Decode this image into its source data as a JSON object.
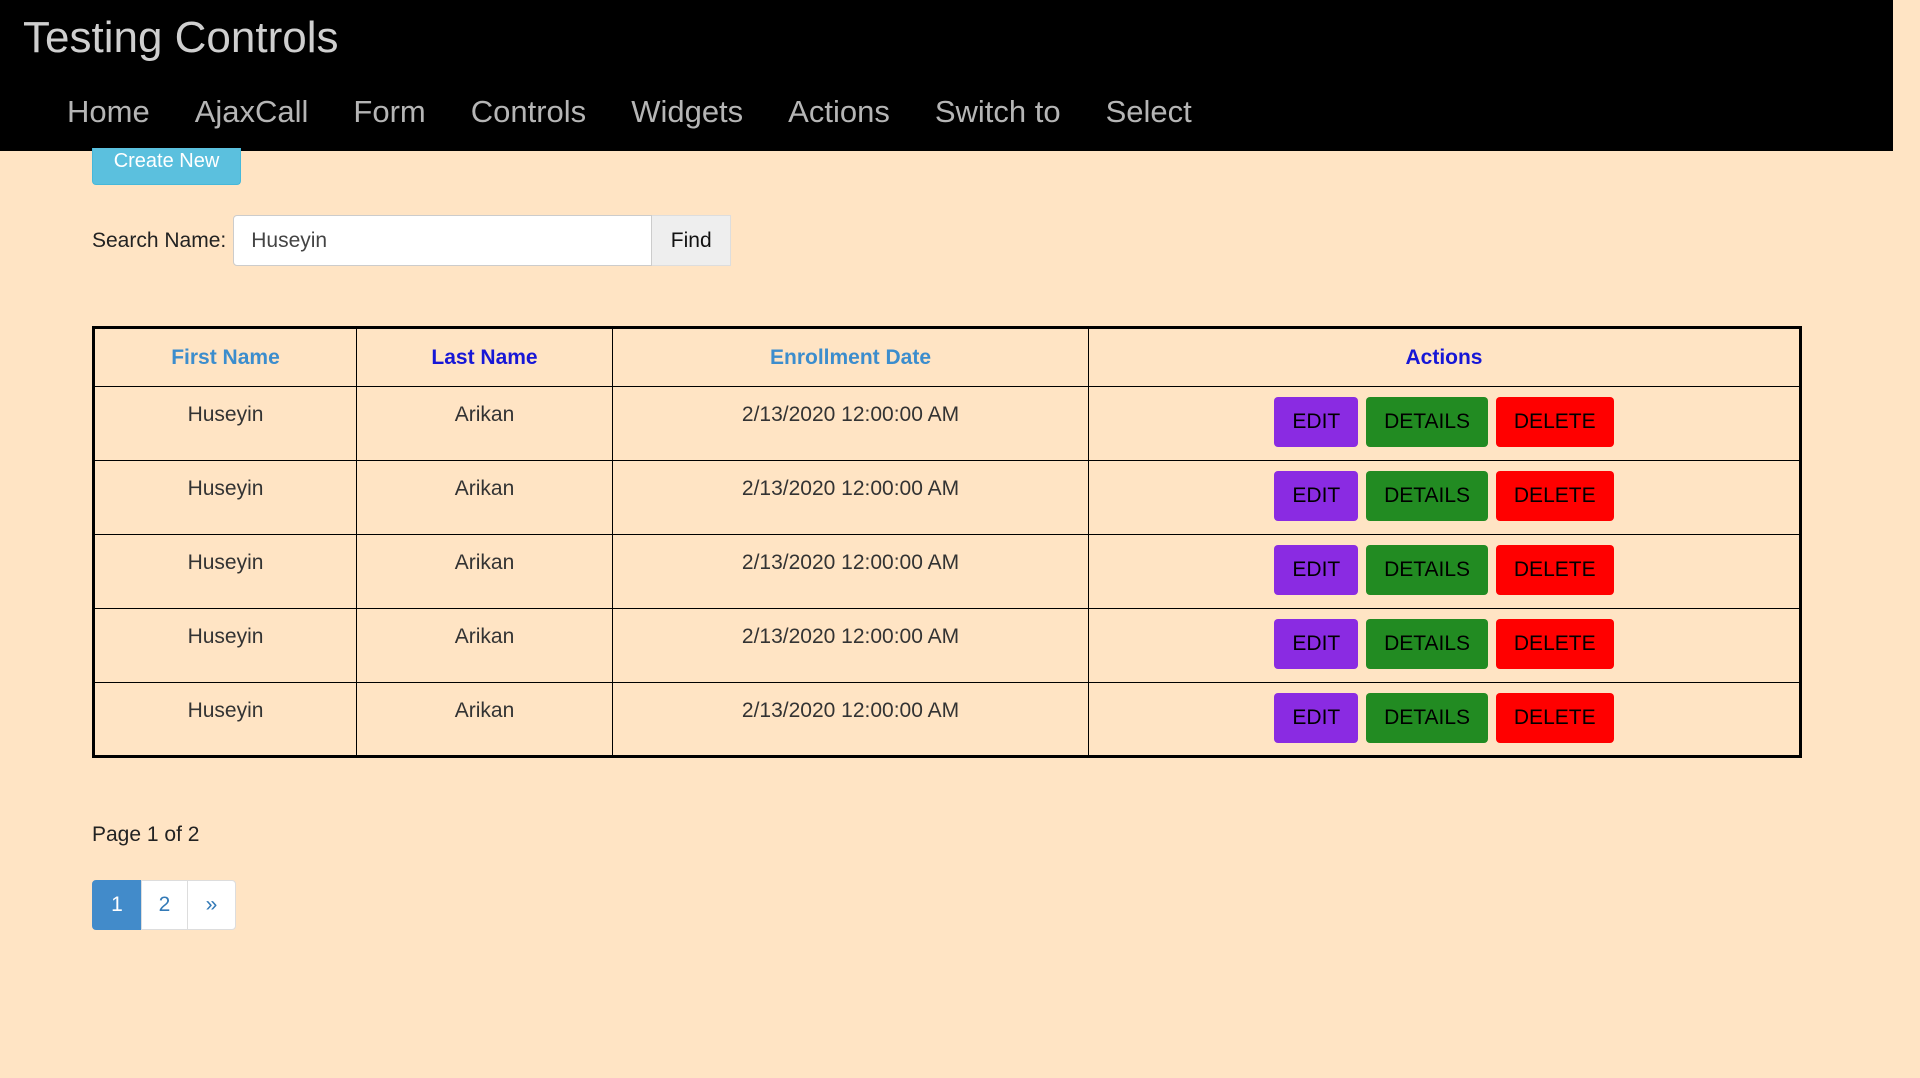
{
  "app": {
    "title": "Testing Controls"
  },
  "nav": {
    "items": [
      "Home",
      "AjaxCall",
      "Form",
      "Controls",
      "Widgets",
      "Actions",
      "Switch to",
      "Select"
    ]
  },
  "toolbar": {
    "create_label": "Create New"
  },
  "search": {
    "label": "Search Name:",
    "value": "Huseyin",
    "button_label": "Find"
  },
  "table": {
    "headers": [
      "First Name",
      "Last Name",
      "Enrollment Date",
      "Actions"
    ],
    "rows": [
      {
        "first": "Huseyin",
        "last": "Arikan",
        "date": "2/13/2020 12:00:00 AM"
      },
      {
        "first": "Huseyin",
        "last": "Arikan",
        "date": "2/13/2020 12:00:00 AM"
      },
      {
        "first": "Huseyin",
        "last": "Arikan",
        "date": "2/13/2020 12:00:00 AM"
      },
      {
        "first": "Huseyin",
        "last": "Arikan",
        "date": "2/13/2020 12:00:00 AM"
      },
      {
        "first": "Huseyin",
        "last": "Arikan",
        "date": "2/13/2020 12:00:00 AM"
      }
    ],
    "row_actions": {
      "edit": "EDIT",
      "details": "DETAILS",
      "delete": "DELETE"
    }
  },
  "paging": {
    "info": "Page 1 of 2",
    "pages": [
      "1",
      "2"
    ],
    "next": "»",
    "current": "1"
  },
  "colors": {
    "background": "#ffe4c4",
    "navbar": "#000000",
    "create_button": "#5bc0de",
    "edit": "#8a2be2",
    "details": "#228b22",
    "delete": "#ff0000",
    "active_page": "#428bca"
  }
}
